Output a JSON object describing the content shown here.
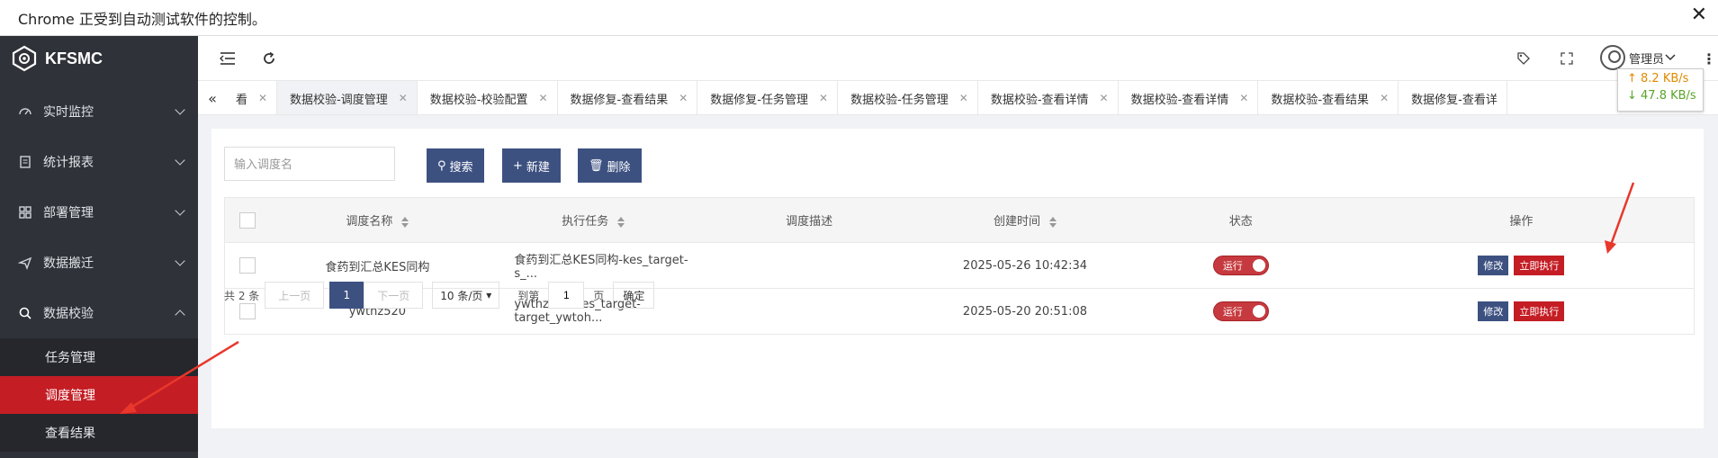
{
  "browser": {
    "infobar_text": "Chrome 正受到自动测试软件的控制。",
    "close_glyph": "✕"
  },
  "sidebar": {
    "logo_text": "KFSMC",
    "menu": [
      {
        "label": "实时监控",
        "icon": "dashboard-icon"
      },
      {
        "label": "统计报表",
        "icon": "report-icon"
      },
      {
        "label": "部署管理",
        "icon": "deploy-icon"
      },
      {
        "label": "数据搬迁",
        "icon": "migrate-icon"
      },
      {
        "label": "数据校验",
        "icon": "search-icon"
      }
    ],
    "submenu": [
      {
        "label": "任务管理"
      },
      {
        "label": "调度管理",
        "active": true
      },
      {
        "label": "查看结果"
      }
    ]
  },
  "header": {
    "user_name": "管理员",
    "speed_up": "↑ 8.2 KB/s",
    "speed_down": "↓ 47.8 KB/s",
    "more_glyph": "⋮"
  },
  "tabs": [
    {
      "label": "看",
      "partial": true
    },
    {
      "label": "数据校验-调度管理",
      "active": true
    },
    {
      "label": "数据校验-校验配置"
    },
    {
      "label": "数据修复-查看结果"
    },
    {
      "label": "数据修复-任务管理"
    },
    {
      "label": "数据校验-任务管理"
    },
    {
      "label": "数据校验-查看详情"
    },
    {
      "label": "数据校验-查看详情"
    },
    {
      "label": "数据校验-查看结果"
    },
    {
      "label": "数据修复-查看详"
    }
  ],
  "toolbar": {
    "search_placeholder": "输入调度名",
    "search_label": "搜索",
    "new_label": "新建",
    "delete_label": "删除"
  },
  "table": {
    "columns": [
      "调度名称",
      "执行任务",
      "调度描述",
      "创建时间",
      "状态",
      "操作"
    ],
    "rows": [
      {
        "name": "食药到汇总KES同构",
        "task": "食药到汇总KES同构-kes_target-s_...",
        "desc": "",
        "created": "2025-05-26 10:42:34",
        "status": "运行",
        "edit": "修改",
        "run": "立即执行"
      },
      {
        "name": "ywthz520",
        "task": "ywthz520-kes_target-target_ywtoh...",
        "desc": "",
        "created": "2025-05-20 20:51:08",
        "status": "运行",
        "edit": "修改",
        "run": "立即执行"
      }
    ]
  },
  "pager": {
    "total": "共 2 条",
    "prev": "上一页",
    "page": "1",
    "next": "下一页",
    "size": "10 条/页",
    "goto_label": "到第",
    "goto_value": "1",
    "page_unit": "页",
    "confirm": "确定"
  },
  "colors": {
    "accent": "#3d5181",
    "danger": "#c41d24",
    "sidebar_bg": "#2f3238"
  }
}
